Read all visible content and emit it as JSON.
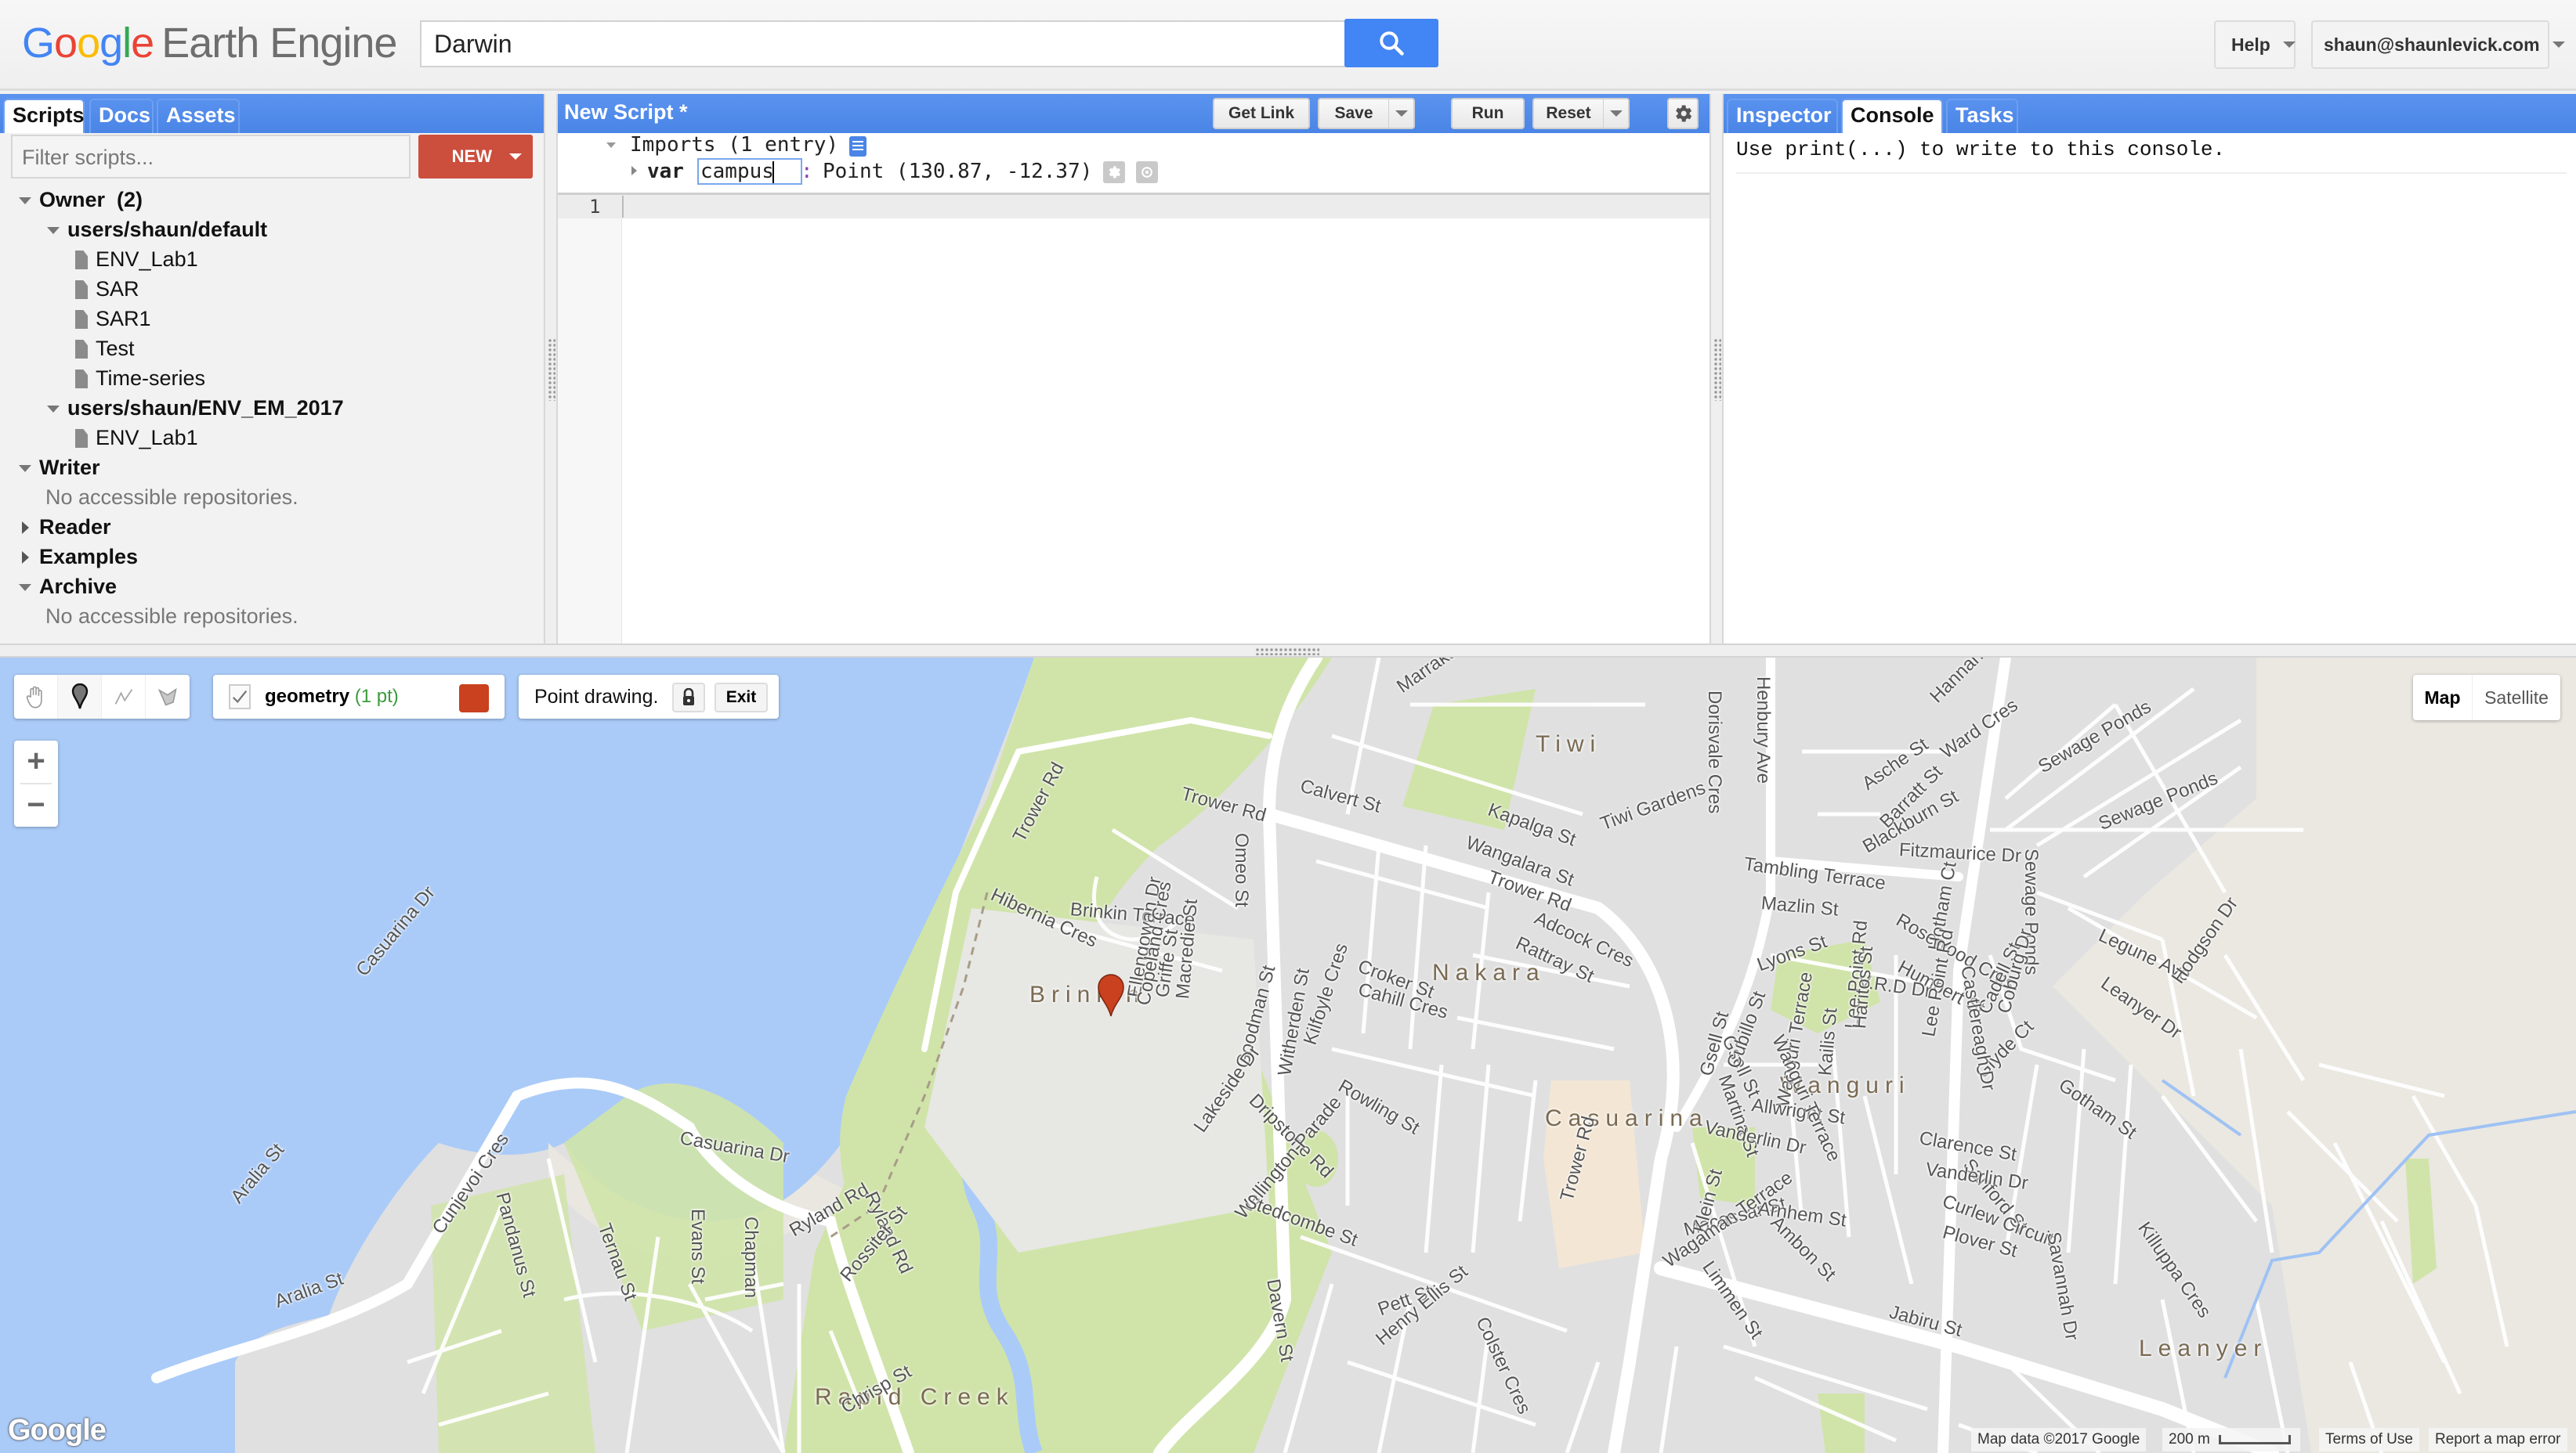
{
  "app": {
    "logo_letters": [
      "G",
      "o",
      "o",
      "g",
      "l",
      "e"
    ],
    "logo_product": "Earth Engine",
    "search_value": "Darwin",
    "help_label": "Help",
    "account_label": "shaun@shaunlevick.com",
    "colors": {
      "accent_blue": "#4a85e6",
      "new_button_red": "#cc4e3d",
      "geometry_color": "#c9411f",
      "water": "#aacbf8",
      "park": "#d0e4a9"
    }
  },
  "left_panel": {
    "tabs": [
      {
        "label": "Scripts",
        "active": true
      },
      {
        "label": "Docs",
        "active": false
      },
      {
        "label": "Assets",
        "active": false
      }
    ],
    "filter_placeholder": "Filter scripts...",
    "new_label": "NEW",
    "tree": {
      "owner": {
        "label": "Owner",
        "count": "(2)"
      },
      "repo1": {
        "label": "users/shaun/default",
        "files": [
          "ENV_Lab1",
          "SAR",
          "SAR1",
          "Test",
          "Time-series"
        ]
      },
      "repo2": {
        "label": "users/shaun/ENV_EM_2017",
        "files": [
          "ENV_Lab1"
        ]
      },
      "writer": {
        "label": "Writer",
        "empty": "No accessible repositories."
      },
      "reader": {
        "label": "Reader"
      },
      "examples": {
        "label": "Examples"
      },
      "archive": {
        "label": "Archive",
        "empty": "No accessible repositories."
      }
    }
  },
  "editor": {
    "title": "New Script *",
    "buttons": {
      "get_link": "Get Link",
      "save": "Save",
      "run": "Run",
      "reset": "Reset"
    },
    "imports_header": "Imports (1 entry)",
    "import_keyword": "var",
    "import_name": "campus",
    "import_colon": ":",
    "import_value": "Point (130.87, -12.37)",
    "line_numbers": [
      "1"
    ]
  },
  "right_panel": {
    "tabs": [
      {
        "label": "Inspector",
        "active": false
      },
      {
        "label": "Console",
        "active": true
      },
      {
        "label": "Tasks",
        "active": false
      }
    ],
    "console_message": "Use print(...) to write to this console."
  },
  "map": {
    "layer_name": "geometry",
    "layer_count": "(1 pt)",
    "drawing_status": "Point drawing.",
    "exit_label": "Exit",
    "zoom_in": "+",
    "zoom_out": "−",
    "map_type_map": "Map",
    "map_type_satellite": "Satellite",
    "map_type_active": "Map",
    "google_logo": "Google",
    "attribution": "Map data ©2017 Google",
    "scale_label": "200 m",
    "terms": "Terms of Use",
    "report": "Report a map error",
    "suburbs": [
      "Tiwi",
      "Brinkin",
      "Nakara",
      "Casuarina",
      "Wanguri",
      "Rapid Creek",
      "Leanyer"
    ],
    "streets": [
      "Marrakai St",
      "Calvert St",
      "Trower Rd",
      "Kapalga St",
      "Wangalara St",
      "Tiwi Gardens",
      "Dorisvale Cres",
      "Henbury Ave",
      "Trower Rd",
      "Omeo St",
      "Brinkin Terrace",
      "Hibernia Cres",
      "Trower Rd",
      "Ellengowan Dr",
      "Copeland Cres",
      "Griffe St",
      "Macredie St",
      "Adcock Cres",
      "Rattray St",
      "Asche St",
      "Barratt St",
      "Blackburn St",
      "Ward Cres",
      "Hannan St",
      "Fitzmaurice Dr",
      "Tambling Terrace",
      "Lee Point Rd",
      "Mazlin St",
      "Lyons St",
      "Gsell St",
      "Martina St",
      "Wanguri Terrace",
      "Kailis St",
      "Rosewood Cres",
      "Humbert St",
      "V.R.D Dr",
      "Cadell St",
      "Glyde Ct",
      "Sanford St",
      "Sewage Ponds",
      "Sewage Ponds",
      "Sewage Ponds",
      "Croker St",
      "Cahill Cres",
      "Goodman St",
      "Witherden St",
      "Kilfoyle Cres",
      "Lakeside Dr",
      "Dripstone Rd",
      "Rowling St",
      "Trower Rd",
      "Vanderlin Dr",
      "Allwright St",
      "Gsell St",
      "Cubillo St",
      "Wanguri Terrace",
      "Haritos St",
      "Wellington Parade",
      "Stedcombe St",
      "Macassar St",
      "Klein St",
      "Arnhem St",
      "Ambon St",
      "Wagaman Terrace",
      "Limmen St",
      "Pett St",
      "Henry Ellis St",
      "Davern St",
      "Colster Cres",
      "Hotham Ct",
      "Castlereagh Dr",
      "Coburg Dr",
      "Legune Ave",
      "Leanyer Dr",
      "Hodgson Dr",
      "Gotham St",
      "Clarence St",
      "Vanderlin Dr",
      "Curlew Circuit",
      "Plover St",
      "Savannah Dr",
      "Killuppa Cres",
      "Jabiru St",
      "Lee Point Rd",
      "Casuarina Dr",
      "Aralia St",
      "Casuarina Dr",
      "Ryland Rd",
      "Ryland Rd",
      "Aralia St",
      "Cunjevoi Cres",
      "Pandanus St",
      "Ternau St",
      "Evans St",
      "Chapman",
      "Rossiter St",
      "Chrisp St"
    ]
  }
}
